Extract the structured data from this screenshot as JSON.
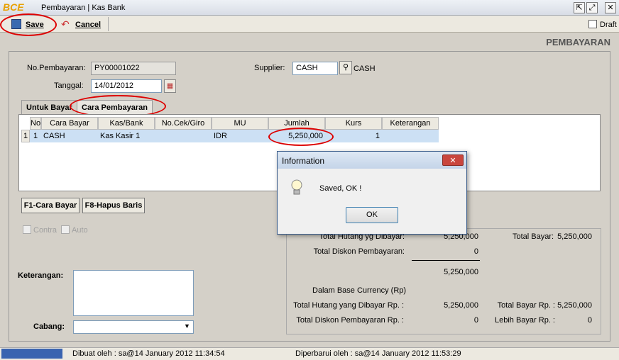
{
  "window": {
    "logo": "BCE",
    "title": "Pembayaran | Kas Bank",
    "btn_restore": "⇱",
    "btn_max": "⤢",
    "btn_close": "✕"
  },
  "toolbar": {
    "save_label": "Save",
    "cancel_label": "Cancel",
    "draft_label": "Draft"
  },
  "page_header": "PEMBAYARAN",
  "form": {
    "no_pembayaran_label": "No.Pembayaran:",
    "no_pembayaran": "PY00001022",
    "tanggal_label": "Tanggal:",
    "tanggal": "14/01/2012",
    "supplier_label": "Supplier:",
    "supplier": "CASH",
    "supplier_name": "CASH"
  },
  "tabs": [
    "Untuk Bayar",
    "Cara Pembayaran"
  ],
  "grid": {
    "headers": [
      "No",
      "Cara Bayar",
      "Kas/Bank",
      "No.Cek/Giro",
      "MU",
      "Jumlah",
      "Kurs",
      "Keterangan"
    ],
    "row_index": "1",
    "row": [
      "1",
      "CASH",
      "Kas Kasir 1",
      "",
      "IDR",
      "5,250,000",
      "1",
      ""
    ]
  },
  "buttons": {
    "f1": "F1-Cara Bayar",
    "f8": "F8-Hapus Baris"
  },
  "checks": {
    "contra": "Contra",
    "auto": "Auto"
  },
  "bottom": {
    "keterangan_label": "Keterangan:",
    "cabang_label": "Cabang:"
  },
  "summary": {
    "total_hutang_label": "Total Hutang yg Dibayar:",
    "total_hutang": "5,250,000",
    "total_diskon_label": "Total Diskon Pembayaran:",
    "total_diskon": "0",
    "subtotal": "5,250,000",
    "total_bayar_label": "Total Bayar:",
    "total_bayar": "5,250,000",
    "base_currency_label": "Dalam Base Currency (Rp)",
    "total_hutang_rp_label": "Total Hutang yang Dibayar Rp. :",
    "total_hutang_rp": "5,250,000",
    "total_diskon_rp_label": "Total Diskon Pembayaran Rp. :",
    "total_diskon_rp": "0",
    "total_bayar_rp_label": "Total Bayar Rp. :",
    "total_bayar_rp": "5,250,000",
    "lebih_bayar_rp_label": "Lebih Bayar Rp. :",
    "lebih_bayar_rp": "0"
  },
  "status": {
    "dibuat": "Dibuat oleh : sa@14 January 2012  11:34:54",
    "diperbarui": "Diperbarui oleh : sa@14 January 2012  11:53:29"
  },
  "dialog": {
    "title": "Information",
    "message": "Saved, OK !",
    "ok_label": "OK",
    "close": "✕"
  }
}
